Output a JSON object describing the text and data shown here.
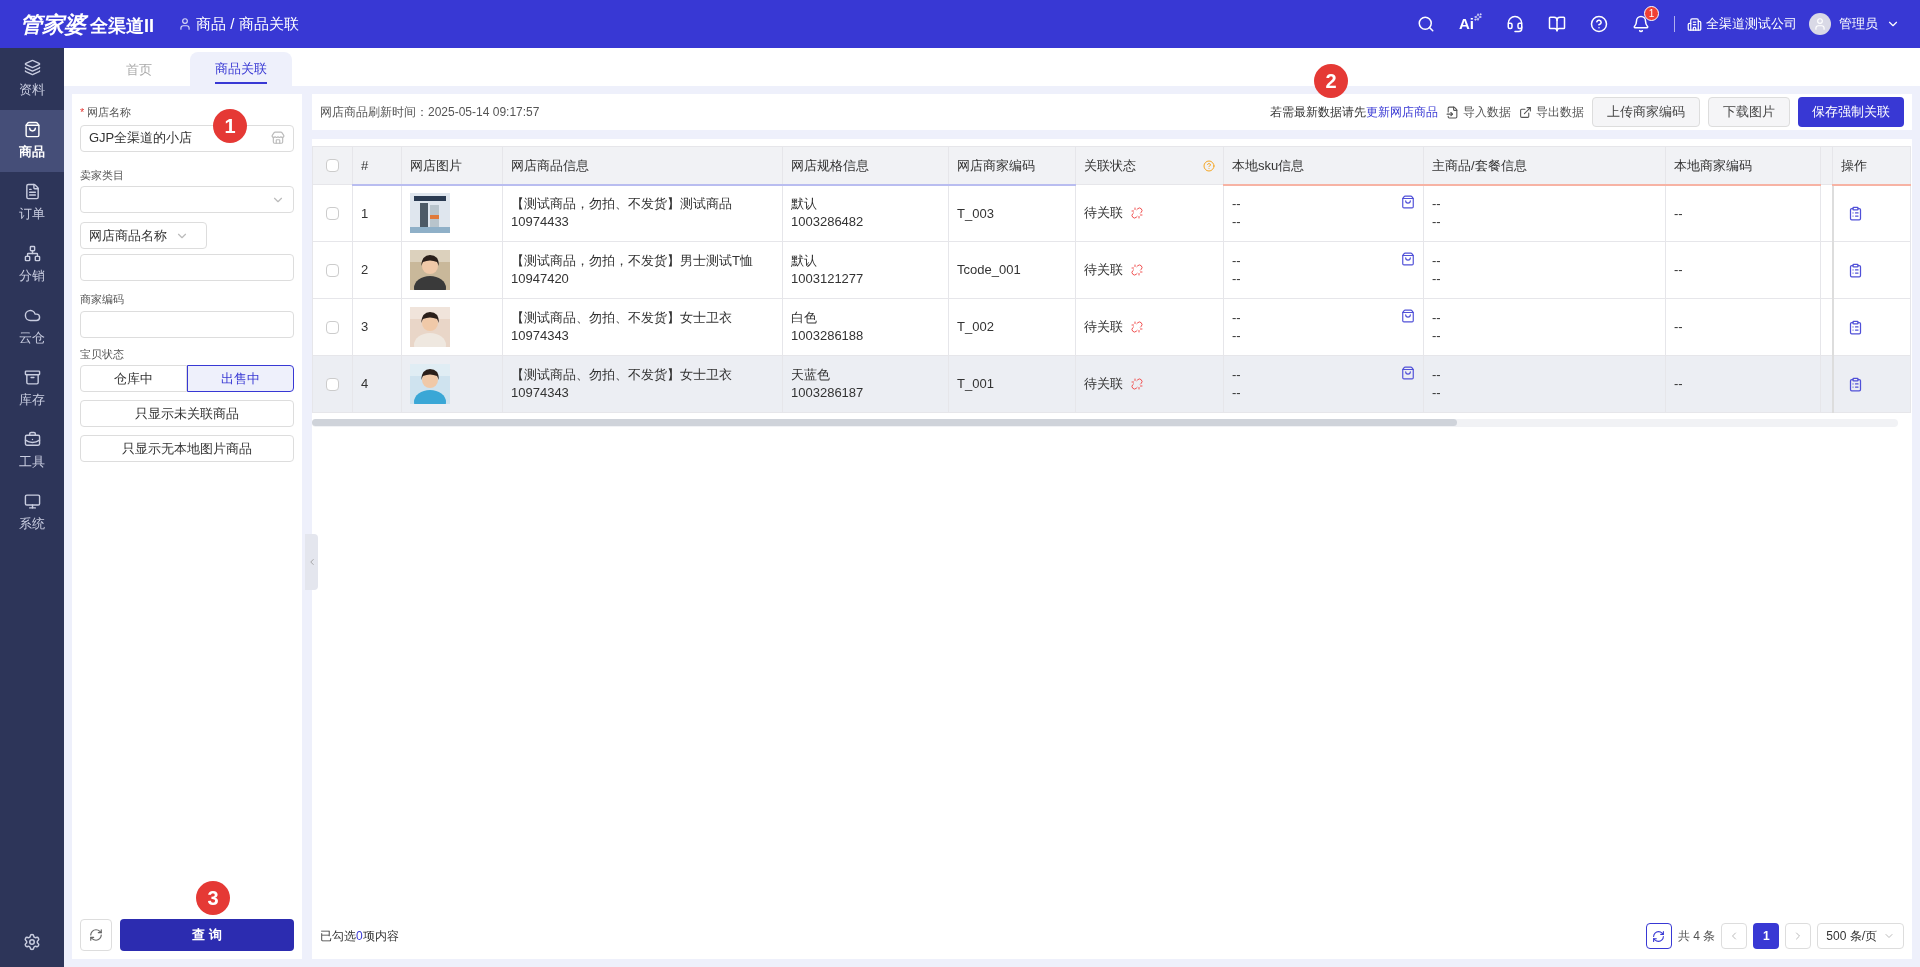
{
  "topbar": {
    "logo": "管家婆",
    "logo_sub": "全渠道II",
    "breadcrumb": "商品 / 商品关联",
    "ai": "Ai",
    "bell_count": "1",
    "company": "全渠道测试公司",
    "user": "管理员"
  },
  "sidebar": {
    "items": [
      {
        "label": "资料",
        "selected": false
      },
      {
        "label": "商品",
        "selected": true
      },
      {
        "label": "订单",
        "selected": false
      },
      {
        "label": "分销",
        "selected": false
      },
      {
        "label": "云仓",
        "selected": false
      },
      {
        "label": "库存",
        "selected": false
      },
      {
        "label": "工具",
        "selected": false
      },
      {
        "label": "系统",
        "selected": false
      }
    ]
  },
  "tabs": [
    {
      "label": "首页",
      "selected": false
    },
    {
      "label": "商品关联",
      "selected": true
    }
  ],
  "filters": {
    "shop_label": "网店名称",
    "required_mark": "*",
    "shop_value": "GJP全渠道的小店",
    "category_label": "卖家类目",
    "name_select": "网店商品名称",
    "code_label": "商家编码",
    "status_label": "宝贝状态",
    "status_options": [
      {
        "label": "仓库中",
        "selected": false
      },
      {
        "label": "出售中",
        "selected": true
      }
    ],
    "buttons": [
      "只显示未关联商品",
      "只显示无本地图片商品"
    ],
    "query": "查 询"
  },
  "toolbar": {
    "refresh_time": "网店商品刷新时间：2025-05-14 09:17:57",
    "hint": "若需最新数据请先",
    "hint_link": "更新网店商品",
    "import": "导入数据",
    "export": "导出数据",
    "buttons": [
      {
        "label": "上传商家编码",
        "primary": false
      },
      {
        "label": "下载图片",
        "primary": false
      },
      {
        "label": "保存强制关联",
        "primary": true
      }
    ]
  },
  "table": {
    "all_checked": false,
    "columns": [
      "#",
      "网店图片",
      "网店商品信息",
      "网店规格信息",
      "网店商家编码",
      "关联状态",
      "本地sku信息",
      "主商品/套餐信息",
      "本地商家编码",
      "操作"
    ],
    "rows": [
      {
        "checked": false,
        "num": "1",
        "title": "【测试商品，勿拍、不发货】测试商品",
        "product_id": "10974433",
        "spec": "默认",
        "spec_id": "1003286482",
        "code": "T_003",
        "status": "待关联",
        "sku": [
          "--",
          "--"
        ],
        "main": [
          "--",
          "--"
        ],
        "local_code": "--",
        "hover": false
      },
      {
        "checked": false,
        "num": "2",
        "title": "【测试商品，勿拍，不发货】男士测试T恤",
        "product_id": "10947420",
        "spec": "默认",
        "spec_id": "1003121277",
        "code": "Tcode_001",
        "status": "待关联",
        "sku": [
          "--",
          "--"
        ],
        "main": [
          "--",
          "--"
        ],
        "local_code": "--",
        "hover": false
      },
      {
        "checked": false,
        "num": "3",
        "title": "【测试商品、勿拍、不发货】女士卫衣",
        "product_id": "10974343",
        "spec": "白色",
        "spec_id": "1003286188",
        "code": "T_002",
        "status": "待关联",
        "sku": [
          "--",
          "--"
        ],
        "main": [
          "--",
          "--"
        ],
        "local_code": "--",
        "hover": false
      },
      {
        "checked": false,
        "num": "4",
        "title": "【测试商品、勿拍、不发货】女士卫衣",
        "product_id": "10974343",
        "spec": "天蓝色",
        "spec_id": "1003286187",
        "code": "T_001",
        "status": "待关联",
        "sku": [
          "--",
          "--"
        ],
        "main": [
          "--",
          "--"
        ],
        "local_code": "--",
        "hover": true
      }
    ]
  },
  "footer": {
    "selected_prefix": "已勾选",
    "selected_count": "0",
    "selected_suffix": "项内容",
    "total": "共 4 条",
    "pages": [
      {
        "label": "1",
        "selected": true
      }
    ],
    "page_size": "500 条/页"
  },
  "callouts": [
    {
      "label": "1"
    },
    {
      "label": "2"
    },
    {
      "label": "3"
    }
  ]
}
